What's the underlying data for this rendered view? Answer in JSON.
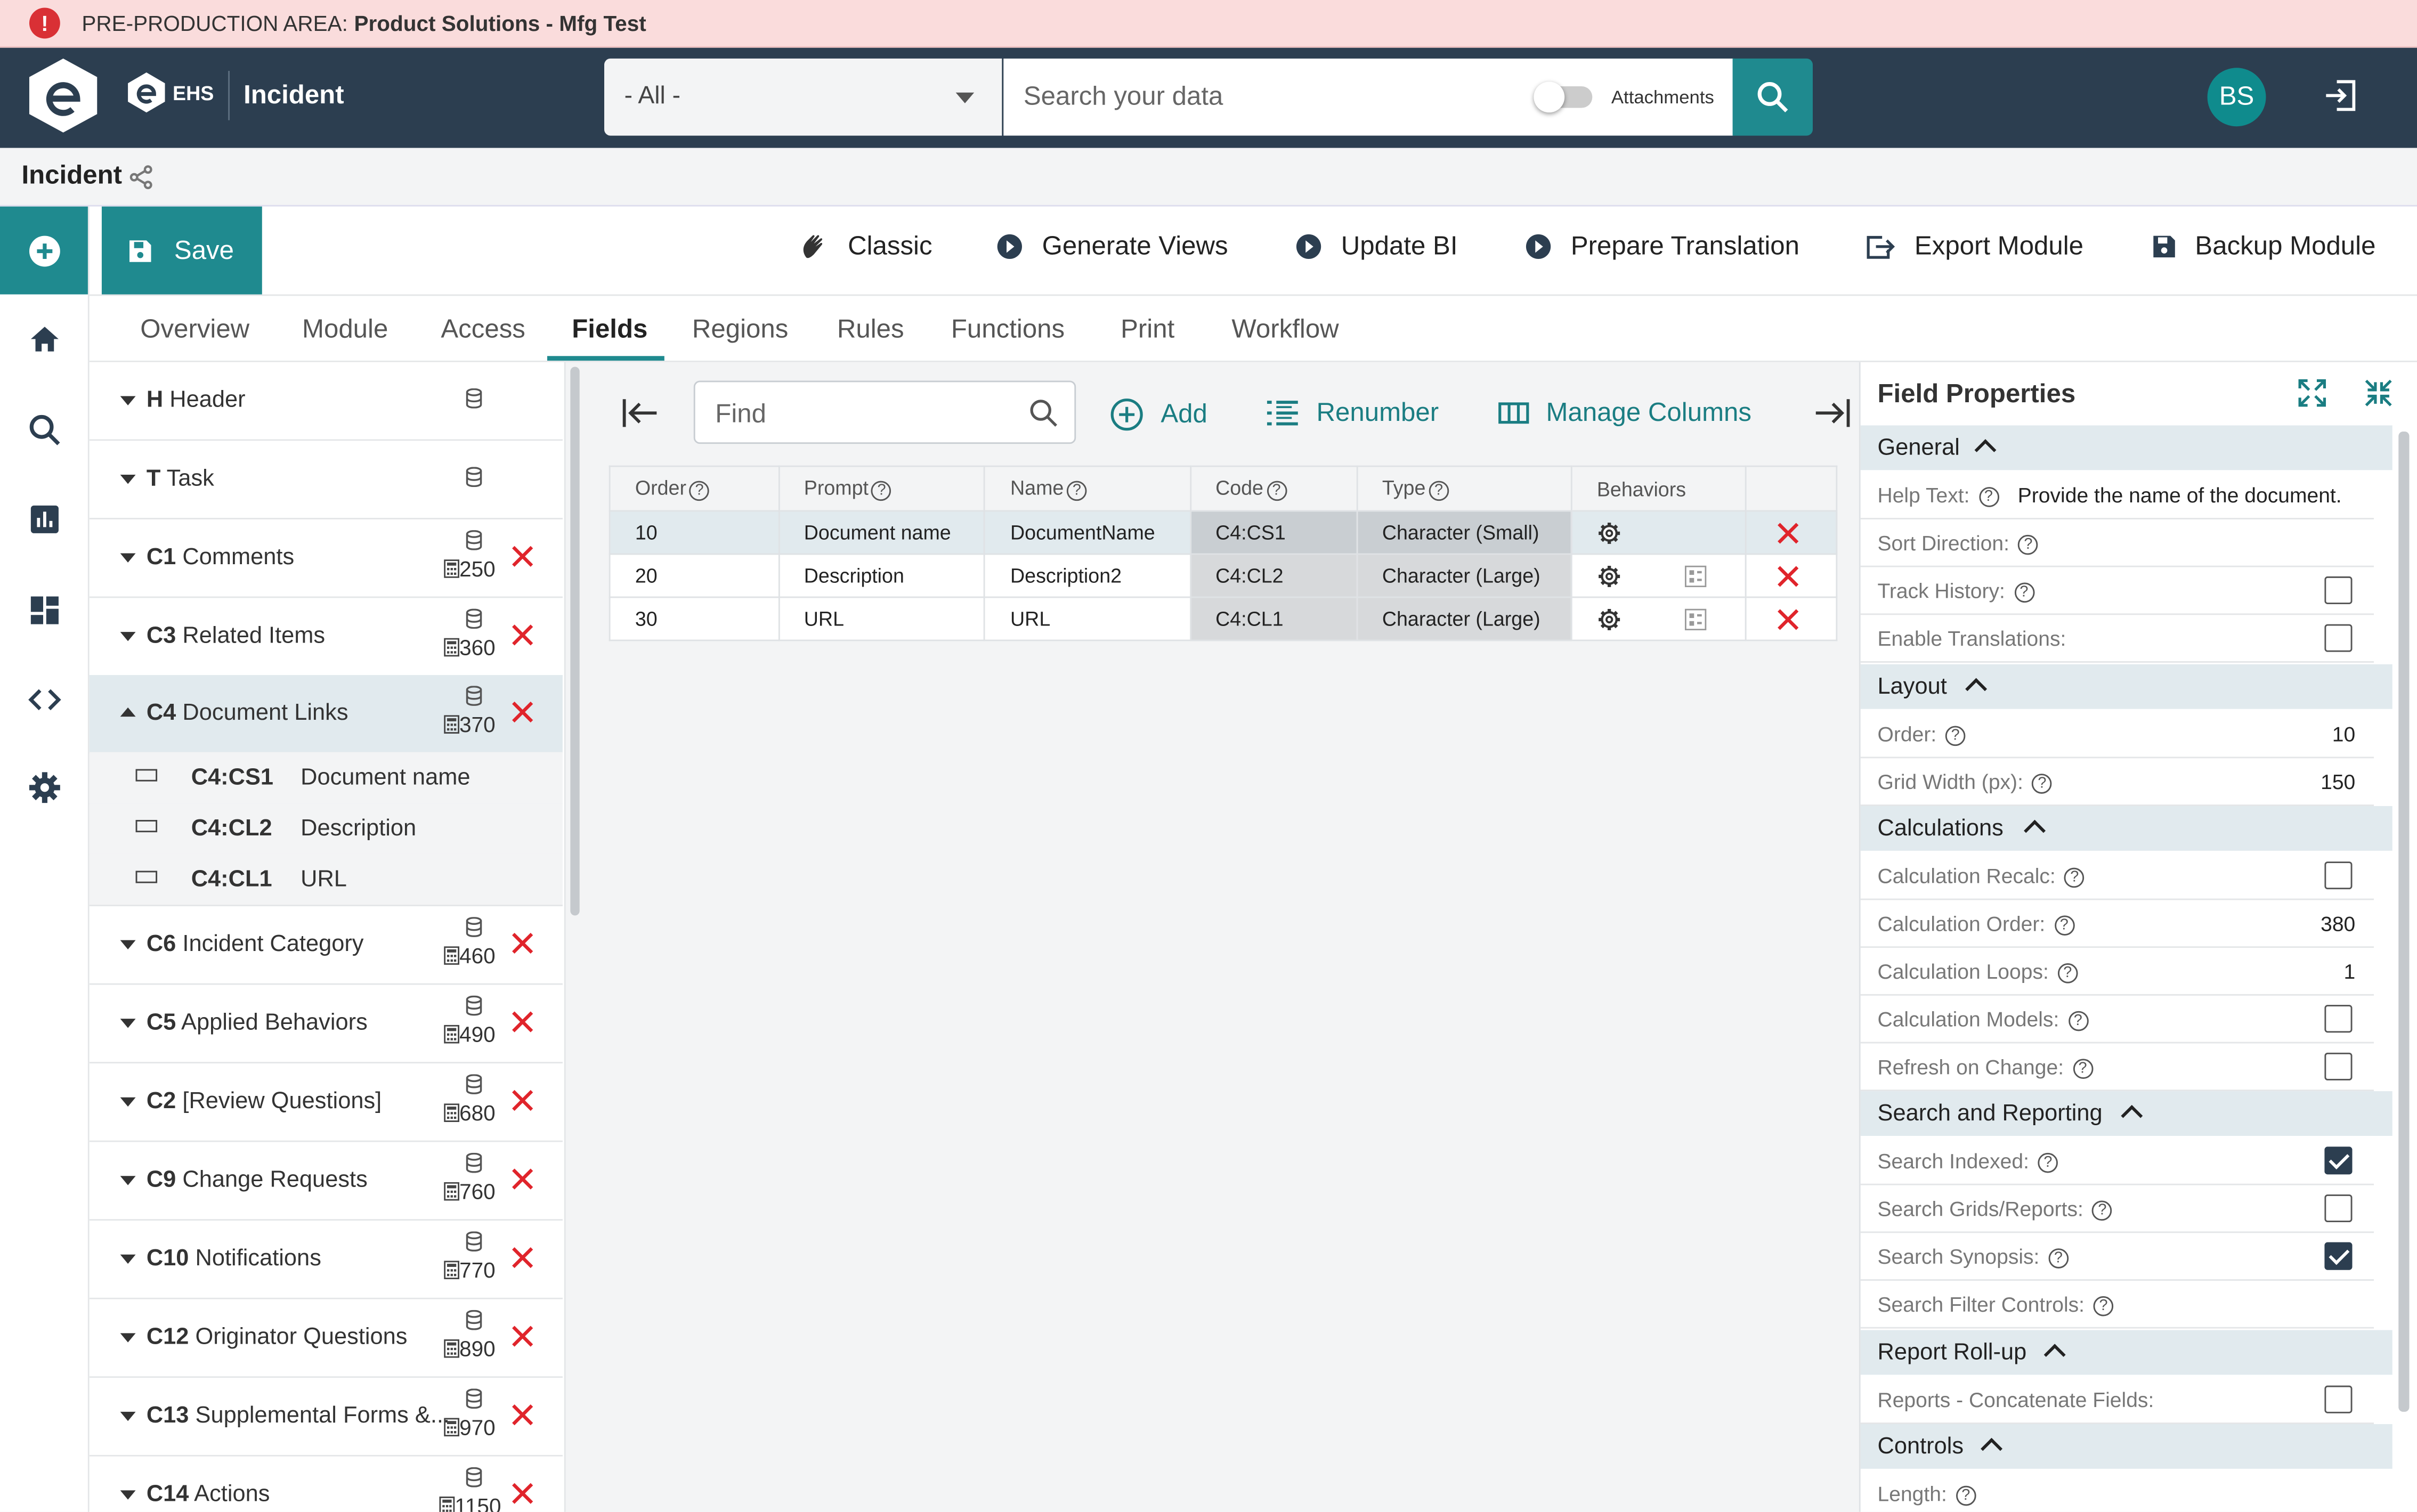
{
  "banner": {
    "prefix": "PRE-PRODUCTION AREA:",
    "name": "Product Solutions - Mfg Test"
  },
  "header": {
    "brand": "EHS",
    "app_title": "Incident",
    "search_scope": "- All -",
    "search_placeholder": "Search your data",
    "attachments_label": "Attachments",
    "user_initials": "BS"
  },
  "breadcrumb": {
    "title": "Incident"
  },
  "toolbar": {
    "save": "Save",
    "classic": "Classic",
    "generate_views": "Generate Views",
    "update_bi": "Update BI",
    "prepare_translation": "Prepare Translation",
    "export_module": "Export Module",
    "backup_module": "Backup Module"
  },
  "tabs": [
    "Overview",
    "Module",
    "Access",
    "Fields",
    "Regions",
    "Rules",
    "Functions",
    "Print",
    "Workflow"
  ],
  "regions": [
    {
      "code": "H",
      "name": "Header",
      "num": ""
    },
    {
      "code": "T",
      "name": "Task",
      "num": ""
    },
    {
      "code": "C1",
      "name": "Comments",
      "num": "250"
    },
    {
      "code": "C3",
      "name": "Related Items",
      "num": "360"
    },
    {
      "code": "C4",
      "name": "Document Links",
      "num": "370"
    },
    {
      "code": "C6",
      "name": "Incident Category",
      "num": "460"
    },
    {
      "code": "C5",
      "name": "Applied Behaviors",
      "num": "490"
    },
    {
      "code": "C2",
      "name": "[Review Questions]",
      "num": "680"
    },
    {
      "code": "C9",
      "name": "Change Requests",
      "num": "760"
    },
    {
      "code": "C10",
      "name": "Notifications",
      "num": "770"
    },
    {
      "code": "C12",
      "name": "Originator Questions",
      "num": "890"
    },
    {
      "code": "C13",
      "name": "Supplemental Forms &...",
      "num": "970"
    },
    {
      "code": "C14",
      "name": "Actions",
      "num": "1150"
    }
  ],
  "region_fields": [
    {
      "code": "C4:CS1",
      "name": "Document name"
    },
    {
      "code": "C4:CL2",
      "name": "Description"
    },
    {
      "code": "C4:CL1",
      "name": "URL"
    }
  ],
  "grid_toolbar": {
    "find_placeholder": "Find",
    "add": "Add",
    "renumber": "Renumber",
    "manage_columns": "Manage Columns"
  },
  "grid": {
    "columns": [
      "Order",
      "Prompt",
      "Name",
      "Code",
      "Type",
      "Behaviors"
    ],
    "rows": [
      {
        "order": "10",
        "prompt": "Document name",
        "name": "DocumentName",
        "code": "C4:CS1",
        "type": "Character (Small)"
      },
      {
        "order": "20",
        "prompt": "Description",
        "name": "Description2",
        "code": "C4:CL2",
        "type": "Character (Large)"
      },
      {
        "order": "30",
        "prompt": "URL",
        "name": "URL",
        "code": "C4:CL1",
        "type": "Character (Large)"
      }
    ]
  },
  "props": {
    "title": "Field Properties",
    "general": "General",
    "help_text_label": "Help Text:",
    "help_text_value": "Provide the name of the document.",
    "sort_direction": "Sort Direction:",
    "track_history": "Track History:",
    "enable_translations": "Enable Translations:",
    "layout": "Layout",
    "order_label": "Order:",
    "order_value": "10",
    "grid_width_label": "Grid Width (px):",
    "grid_width_value": "150",
    "calculations": "Calculations",
    "calc_recalc": "Calculation Recalc:",
    "calc_order_label": "Calculation Order:",
    "calc_order_value": "380",
    "calc_loops_label": "Calculation Loops:",
    "calc_loops_value": "1",
    "calc_models": "Calculation Models:",
    "refresh_on_change": "Refresh on Change:",
    "search_reporting": "Search and Reporting",
    "search_indexed": "Search Indexed:",
    "search_grids": "Search Grids/Reports:",
    "search_synopsis": "Search Synopsis:",
    "search_filter": "Search Filter Controls:",
    "report_rollup": "Report Roll-up",
    "reports_concat": "Reports - Concatenate Fields:",
    "controls": "Controls",
    "length": "Length:"
  },
  "colors": {
    "accent": "#1f8a8f",
    "header": "#2c3e50",
    "delete": "#e0242b",
    "banner": "#fadcdc"
  }
}
